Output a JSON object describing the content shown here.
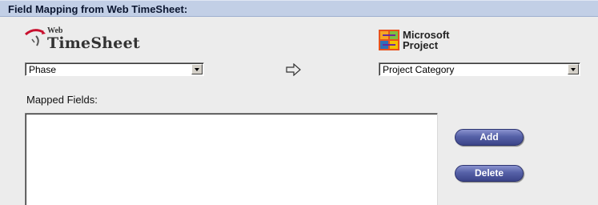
{
  "header": {
    "title": "Field Mapping from Web TimeSheet:"
  },
  "source": {
    "logo_small": "Web",
    "logo_main": "TimeSheet",
    "selected": "Phase"
  },
  "target": {
    "logo_line1": "Microsoft",
    "logo_line2": "Project",
    "selected": "Project Category"
  },
  "mapped": {
    "label": "Mapped Fields:",
    "items": []
  },
  "buttons": {
    "add": "Add",
    "delete": "Delete"
  },
  "icons": {
    "source_logo": "web-timesheet-logo-icon",
    "target_logo": "microsoft-project-logo-icon",
    "map_arrow": "right-arrow-icon",
    "dropdown": "dropdown-arrow-icon"
  },
  "colors": {
    "header_bg": "#c2cfe6",
    "button": "#4b559b",
    "msp_orange": "#e8521c"
  }
}
